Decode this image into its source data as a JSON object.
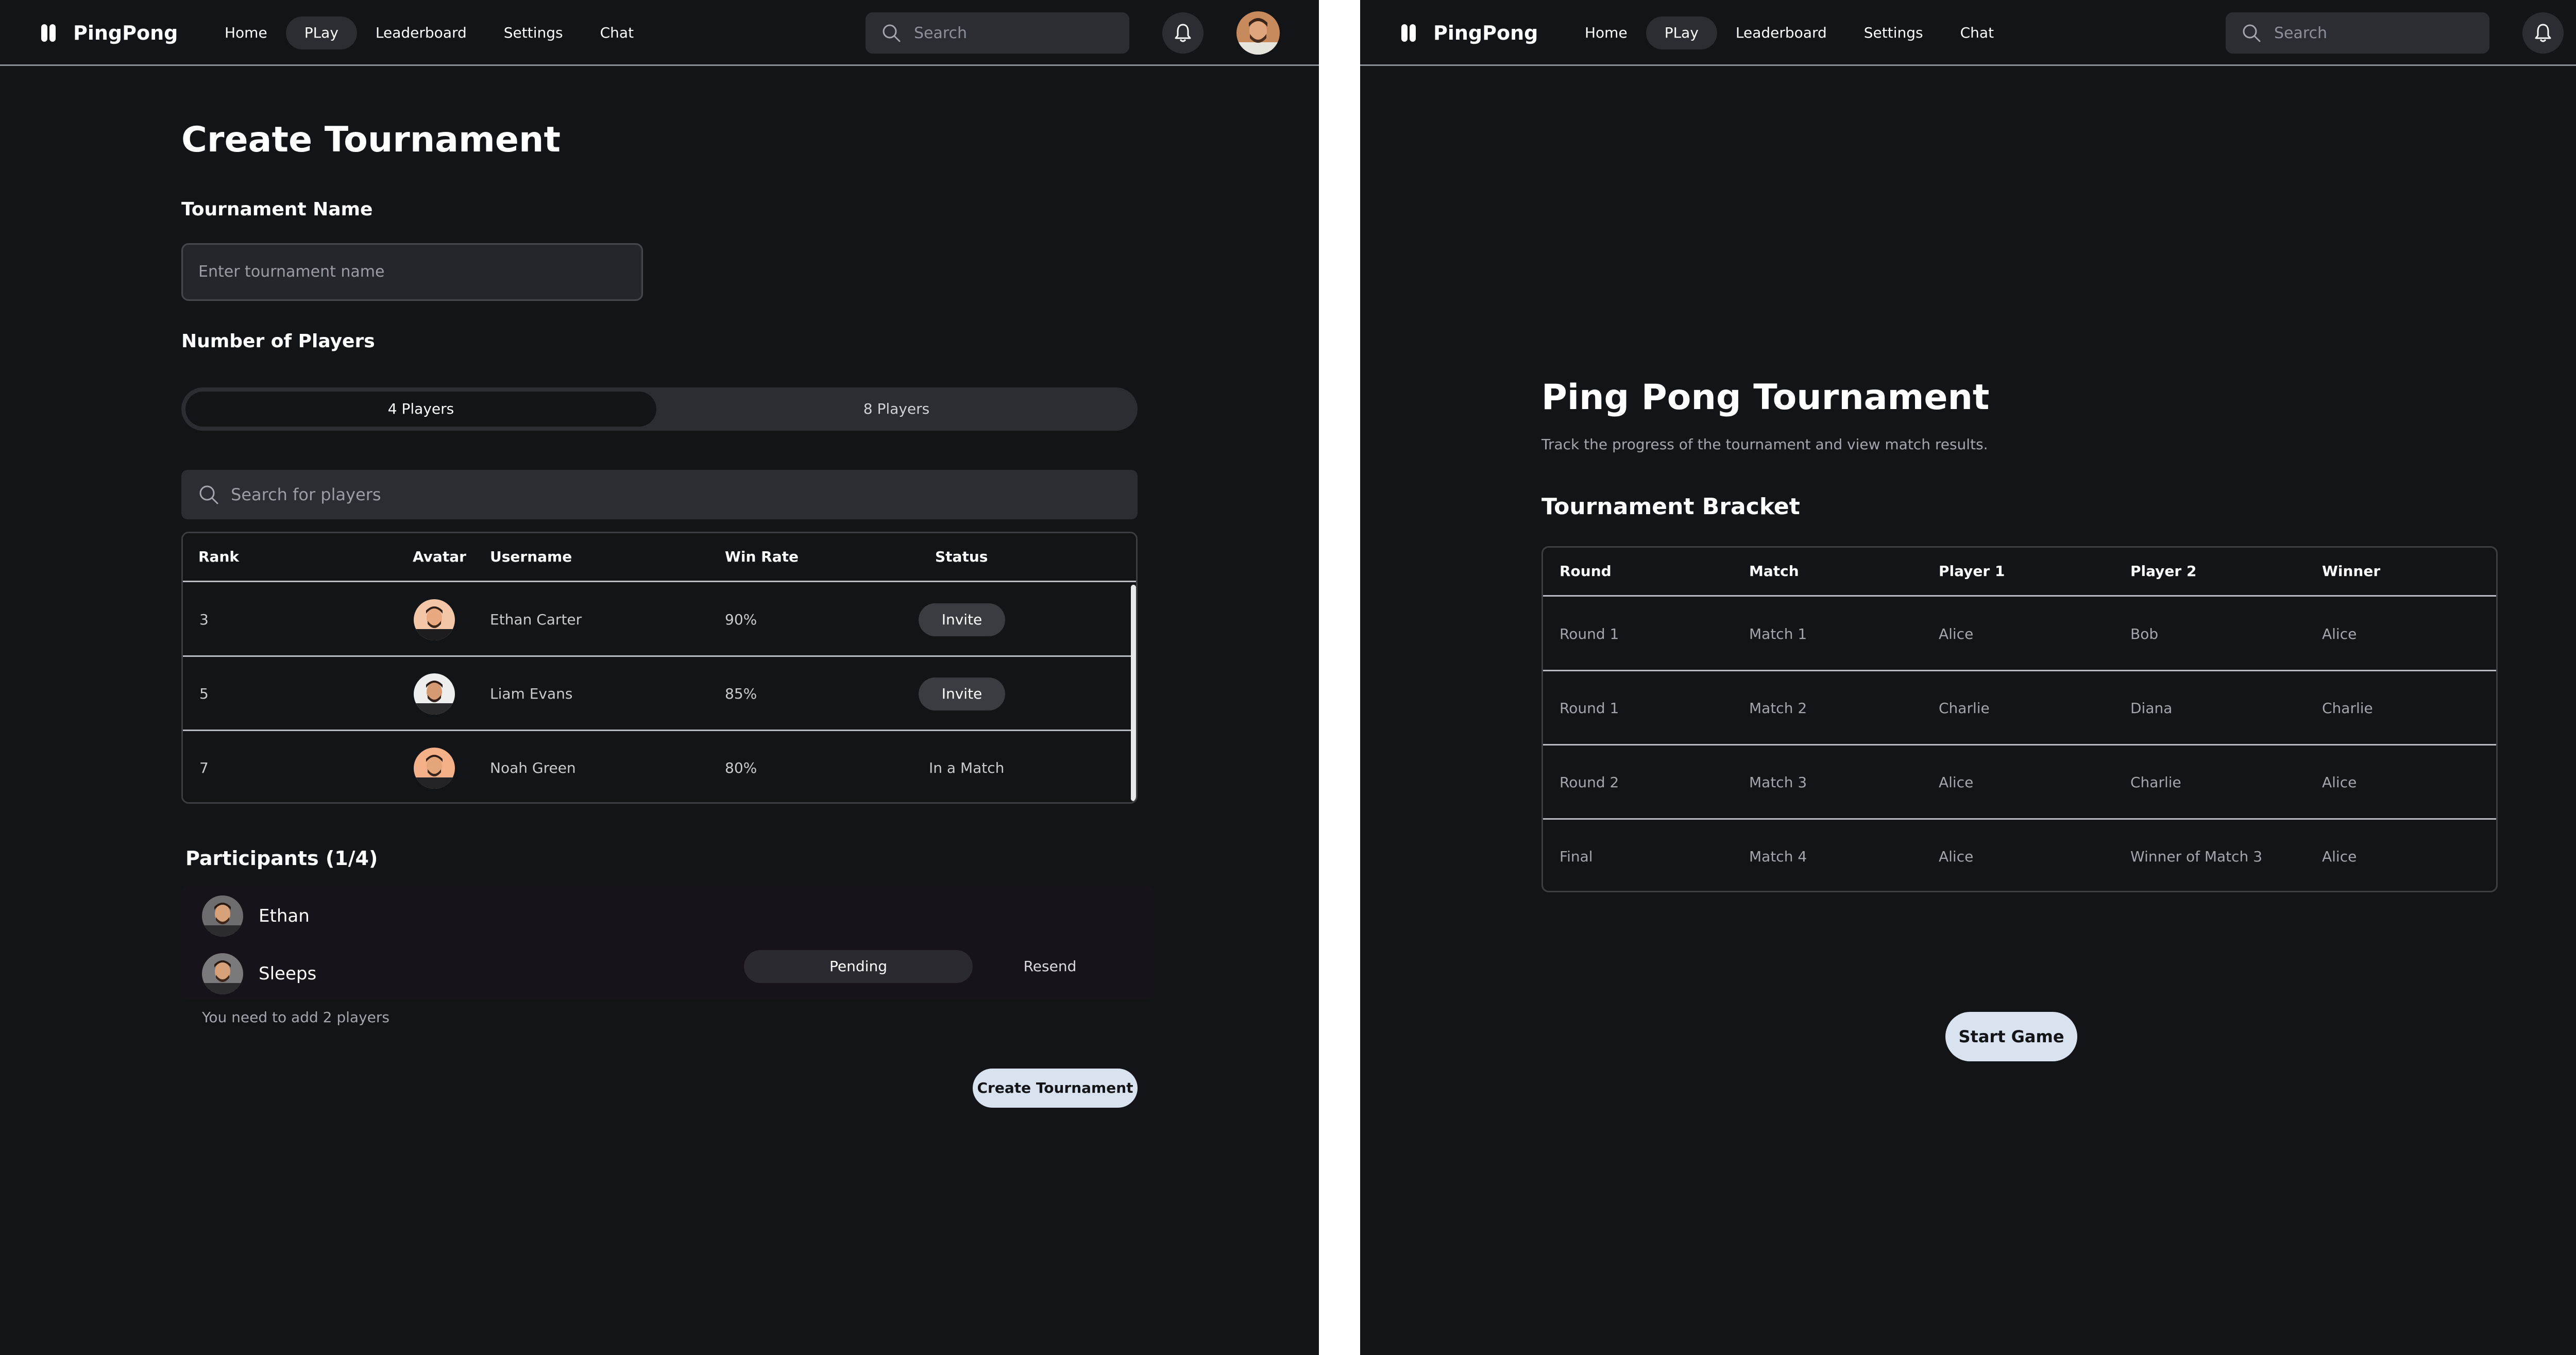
{
  "app": {
    "brand": "PingPong",
    "nav": [
      "Home",
      "PLay",
      "Leaderboard",
      "Settings",
      "Chat"
    ],
    "active_nav": "PLay",
    "search_placeholder": "Search",
    "icons": [
      "pingpong-logo-icon",
      "search-icon",
      "bell-icon",
      "avatar"
    ]
  },
  "create": {
    "title": "Create Tournament",
    "name_label": "Tournament Name",
    "name_placeholder": "Enter tournament name",
    "players_label": "Number of Players",
    "options": [
      "4 Players",
      "8 Players"
    ],
    "selected_option": "4 Players",
    "player_search_placeholder": "Search  for players",
    "table": {
      "headers": [
        "Rank",
        "Avatar",
        "Username",
        "Win Rate",
        "Status"
      ],
      "rows": [
        {
          "rank": "3",
          "username": "Ethan Carter",
          "win_rate": "90%",
          "status": "Invite"
        },
        {
          "rank": "5",
          "username": "Liam Evans",
          "win_rate": "85%",
          "status": "Invite"
        },
        {
          "rank": "7",
          "username": "Noah Green",
          "win_rate": "80%",
          "status": "In a Match"
        }
      ]
    },
    "participants_title": "Participants (1/4)",
    "participants": [
      {
        "name": "Ethan"
      },
      {
        "name": "Sleeps",
        "status": "Pending",
        "action": "Resend"
      }
    ],
    "hint": "You need to add 2 players",
    "create_button": "Create Tournament"
  },
  "bracket": {
    "title": "Ping Pong Tournament",
    "subtitle": "Track the progress of the tournament and view match results.",
    "section_title": "Tournament Bracket",
    "headers": [
      "Round",
      "Match",
      "Player 1",
      "Player 2",
      "Winner"
    ],
    "rows": [
      {
        "round": "Round 1",
        "match": "Match 1",
        "player1": "Alice",
        "player2": "Bob",
        "winner": "Alice"
      },
      {
        "round": "Round 1",
        "match": "Match 2",
        "player1": "Charlie",
        "player2": "Diana",
        "winner": "Charlie"
      },
      {
        "round": "Round 2",
        "match": "Match 3",
        "player1": "Alice",
        "player2": "Charlie",
        "winner": "Alice"
      },
      {
        "round": "Final",
        "match": "Match 4",
        "player1": "Alice",
        "player2": "Winner of Match 3",
        "winner": "Alice"
      }
    ],
    "start_button": "Start Game"
  },
  "colors": {
    "background": "#131417",
    "surface": "#2b2d33",
    "primary_button": "#d9e3f0",
    "muted_text": "#a3a6ad"
  }
}
